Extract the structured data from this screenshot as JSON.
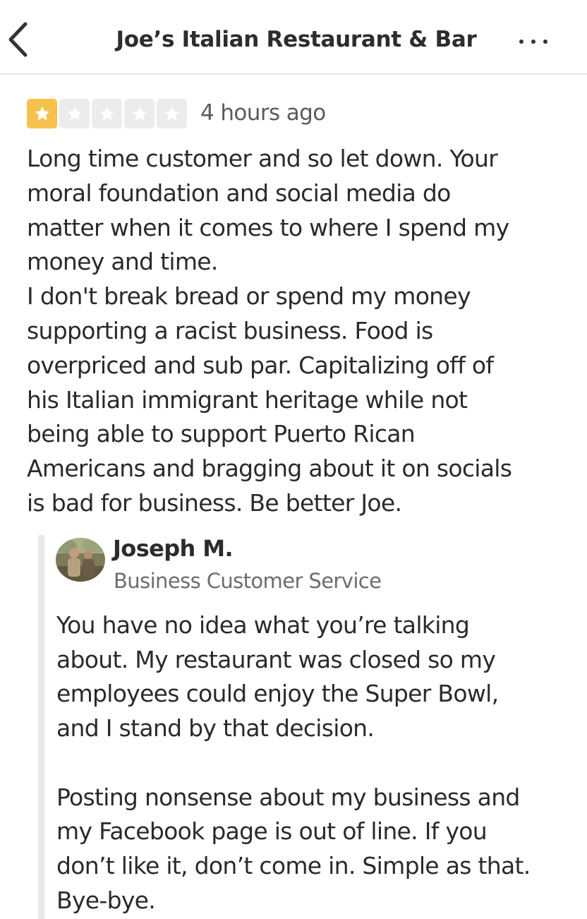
{
  "header": {
    "title": "Joe’s Italian Restaurant & Bar",
    "back_icon": "chevron-left-icon",
    "more_icon": "more-horizontal-icon"
  },
  "review": {
    "rating": 1,
    "rating_max": 5,
    "star_colors": {
      "filled": "#f6c14d",
      "empty": "#ececec"
    },
    "timestamp": "4 hours ago",
    "paragraph_1": "Long time customer and so let down. Your\nmoral foundation and social media do\nmatter when it comes to where I spend my\nmoney and time.",
    "paragraph_2": "I don't break bread or spend my money\nsupporting a racist business. Food is\noverpriced and sub par. Capitalizing off of\nhis Italian immigrant heritage while not\nbeing able to support Puerto Rican\nAmericans and bragging about it on socials\nis bad for business. Be better Joe."
  },
  "owner_reply": {
    "name": "Joseph M.",
    "role": "Business Customer Service",
    "paragraph_1": "You have no idea what you’re talking\nabout. My restaurant was closed so my\nemployees could enjoy the Super Bowl,\nand I stand by that decision.",
    "paragraph_2": "Posting nonsense about my business and\nmy Facebook page is out of line. If you\ndon’t like it, don’t come in. Simple as that.\nBye-bye."
  }
}
